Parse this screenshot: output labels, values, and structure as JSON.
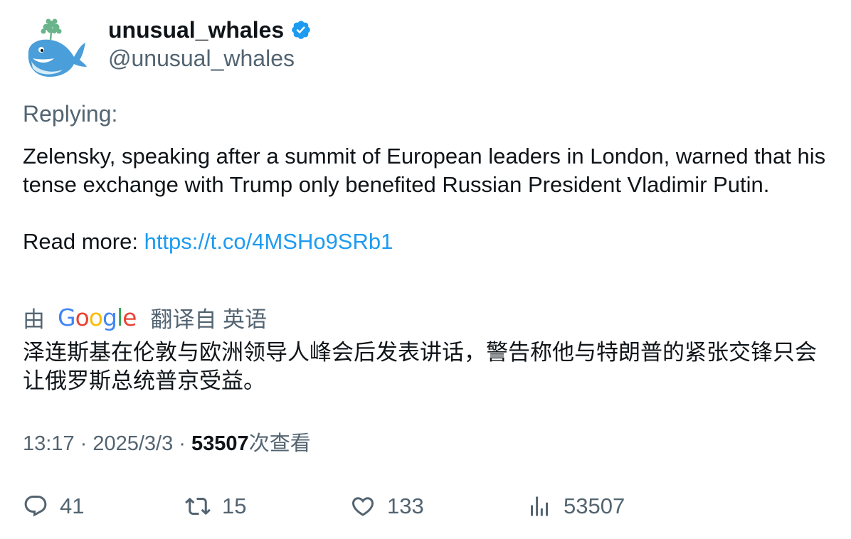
{
  "author": {
    "display_name": "unusual_whales",
    "handle": "@unusual_whales",
    "verified": true,
    "avatar_icon": "whale-avatar-icon"
  },
  "replying_label": "Replying:",
  "tweet": {
    "paragraph1": "Zelensky, speaking after a summit of European leaders in London, warned that his tense exchange with Trump only benefited Russian President Vladimir Putin.",
    "read_more_label": "Read more: ",
    "link": "https://t.co/4MSHo9SRb1"
  },
  "translation": {
    "by_label": "由",
    "provider": "Google",
    "from_label": "翻译自 英语",
    "text": "泽连斯基在伦敦与欧洲领导人峰会后发表讲话，警告称他与特朗普的紧张交锋只会让俄罗斯总统普京受益。"
  },
  "meta": {
    "time": "13:17",
    "separator": " · ",
    "date": "2025/3/3",
    "views_count": "53507",
    "views_label": "次查看"
  },
  "actions": {
    "replies": "41",
    "reposts": "15",
    "likes": "133",
    "views": "53507"
  },
  "colors": {
    "text": "#0f1419",
    "secondary": "#536471",
    "link": "#1d9bf0",
    "verified": "#1d9bf0"
  }
}
